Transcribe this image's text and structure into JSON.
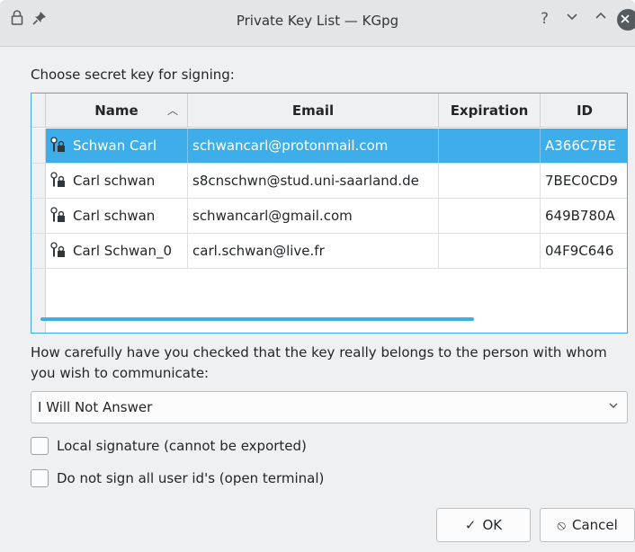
{
  "titlebar": {
    "title": "Private Key List — KGpg",
    "icons": [
      "lock-icon",
      "pin-icon",
      "help-icon",
      "minimize-icon",
      "maximize-icon",
      "close-icon"
    ]
  },
  "dialog": {
    "choose_label": "Choose secret key for signing:",
    "columns": [
      "Name",
      "Email",
      "Expiration",
      "ID"
    ],
    "rows": [
      {
        "name": "Schwan Carl",
        "email": "schwancarl@protonmail.com",
        "expiration": "",
        "id": "A366C7BE",
        "selected": true
      },
      {
        "name": "Carl schwan",
        "email": "s8cnschwn@stud.uni-saarland.de",
        "expiration": "",
        "id": "7BEC0CD9",
        "selected": false
      },
      {
        "name": "Carl schwan",
        "email": "schwancarl@gmail.com",
        "expiration": "",
        "id": "649B780A",
        "selected": false
      },
      {
        "name": "Carl Schwan_0",
        "email": "carl.schwan@live.fr",
        "expiration": "",
        "id": "04F9C646",
        "selected": false
      }
    ],
    "question": "How carefully have you checked that the key really belongs to the person with whom you wish to communicate:",
    "trust_select": {
      "selected": "I Will Not Answer"
    },
    "checkbox_local": {
      "label": "Local signature (cannot be exported)",
      "checked": false
    },
    "checkbox_terminal": {
      "label": "Do not sign all user id's (open terminal)",
      "checked": false
    },
    "ok_label": "OK",
    "cancel_label": "Cancel"
  },
  "colors": {
    "accent": "#3daee9",
    "window_bg": "#eff0f1",
    "titlebar_bg": "#e3e5e7"
  }
}
